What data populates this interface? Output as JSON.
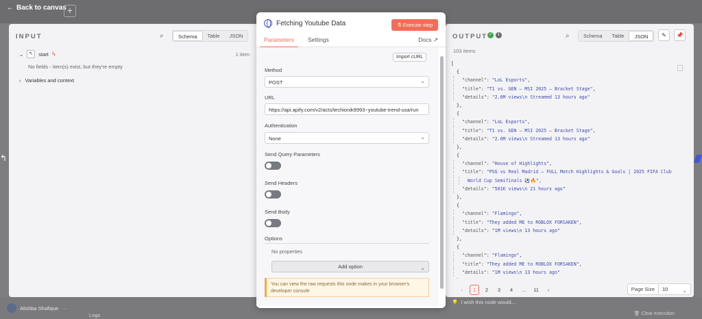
{
  "nav": {
    "back_label": "Back to canvas",
    "plus_label": "+",
    "logs_label": "Logs",
    "clear_label": "Clear execution",
    "user_name": "Alishba Shafique"
  },
  "input": {
    "title": "INPUT",
    "modes": [
      "Schema",
      "Table",
      "JSON"
    ],
    "start_label": "start",
    "item_count": "1 item",
    "no_fields": "No fields - item(s) exist, but they're empty",
    "vars_label": "Variables and context"
  },
  "node": {
    "title": "Fetching Youtube Data",
    "execute_label": "Execute step",
    "tab_parameters": "Parameters",
    "tab_settings": "Settings",
    "docs_label": "Docs",
    "import_label": "Import cURL",
    "method_label": "Method",
    "method_value": "POST",
    "url_label": "URL",
    "url_value": "https://api.apify.com/v2/acts/techionik9993~youtube-trend-usa/run",
    "auth_label": "Authentication",
    "auth_value": "None",
    "send_query_label": "Send Query Parameters",
    "send_headers_label": "Send Headers",
    "send_body_label": "Send Body",
    "options_label": "Options",
    "no_properties": "No properties",
    "add_option_label": "Add option",
    "notice_text": "You can view the raw requests this node makes in your browser's developer console"
  },
  "output": {
    "title": "OUTPUT",
    "modes": [
      "Schema",
      "Table",
      "JSON"
    ],
    "items_count": "103 items",
    "json_lines": [
      {
        "t": "[",
        "d": 0
      },
      {
        "t": "{",
        "d": 1
      },
      {
        "k": "\"channel\"",
        "v": "\"LoL Esports\"",
        "d": 2
      },
      {
        "k": "\"title\"",
        "v": "\"T1 vs. GEN – MSI 2025 – Bracket Stage\"",
        "d": 2
      },
      {
        "k": "\"details\"",
        "v": "\"2.6M views\\n Streamed 13 hours ago\"",
        "d": 2,
        "last": true
      },
      {
        "t": "},",
        "d": 1
      },
      {
        "t": "{",
        "d": 1
      },
      {
        "k": "\"channel\"",
        "v": "\"LoL Esports\"",
        "d": 2
      },
      {
        "k": "\"title\"",
        "v": "\"T1 vs. GEN – MSI 2025 – Bracket Stage\"",
        "d": 2
      },
      {
        "k": "\"details\"",
        "v": "\"2.6M views\\n Streamed 13 hours ago\"",
        "d": 2,
        "last": true
      },
      {
        "t": "},",
        "d": 1
      },
      {
        "t": "{",
        "d": 1
      },
      {
        "k": "\"channel\"",
        "v": "\"House of Highlights\"",
        "d": 2
      },
      {
        "k": "\"title\"",
        "v": "\"PSG vs Real Madrid – FULL Match Highlights & Goals | 2025 FIFA Club",
        "d": 2,
        "nocomma": true
      },
      {
        "t": "World Cup Semifinals ⚽🔥\",",
        "d": 3
      },
      {
        "k": "\"details\"",
        "v": "\"501K views\\n 21 hours ago\"",
        "d": 2,
        "last": true
      },
      {
        "t": "},",
        "d": 1
      },
      {
        "t": "{",
        "d": 1
      },
      {
        "k": "\"channel\"",
        "v": "\"Flamingo\"",
        "d": 2
      },
      {
        "k": "\"title\"",
        "v": "\"They added ME to ROBLOX FORSAKEN\"",
        "d": 2
      },
      {
        "k": "\"details\"",
        "v": "\"1M views\\n 13 hours ago\"",
        "d": 2,
        "last": true
      },
      {
        "t": "},",
        "d": 1
      },
      {
        "t": "{",
        "d": 1
      },
      {
        "k": "\"channel\"",
        "v": "\"Flamingo\"",
        "d": 2
      },
      {
        "k": "\"title\"",
        "v": "\"They added ME to ROBLOX FORSAKEN\"",
        "d": 2
      },
      {
        "k": "\"details\"",
        "v": "\"1M views\\n 13 hours ago\"",
        "d": 2,
        "last": true
      },
      {
        "t": "},",
        "d": 1
      }
    ],
    "pages": [
      "1",
      "2",
      "3",
      "4",
      "...",
      "11"
    ],
    "current_page": "1",
    "page_size_label": "Page Size",
    "page_size_value": "10",
    "wish_text": "I wish this node would..."
  },
  "colors": {
    "accent": "#f26d58",
    "success": "#3fa74a",
    "json_value": "#3d4cb0"
  }
}
